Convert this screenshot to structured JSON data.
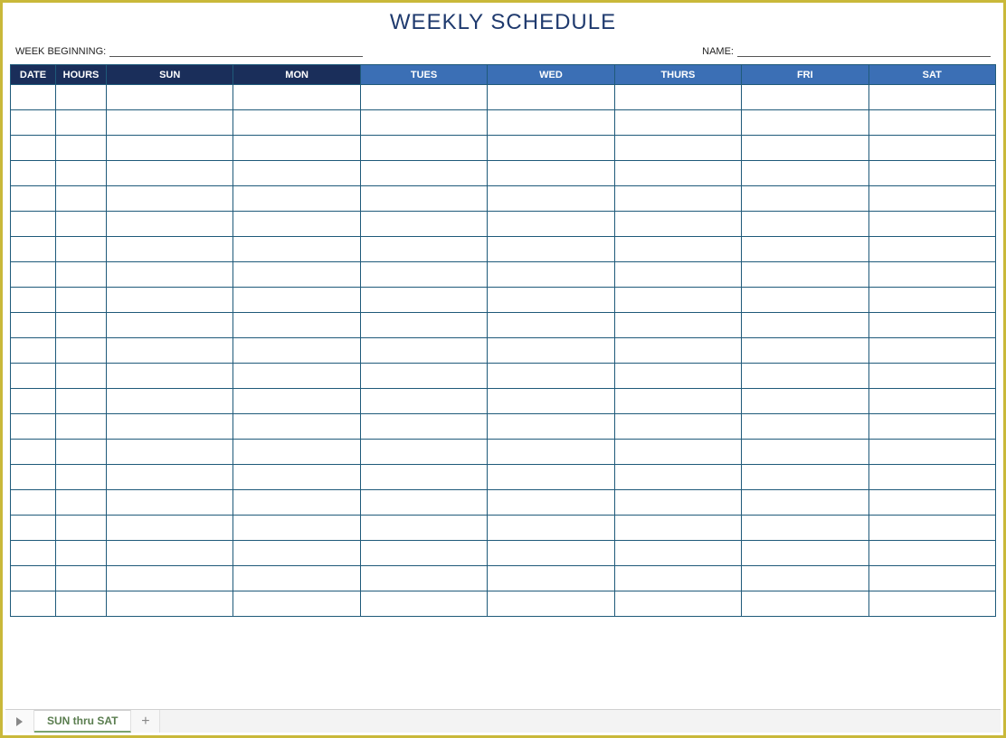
{
  "title": "WEEKLY SCHEDULE",
  "meta": {
    "week_label": "WEEK BEGINNING:",
    "week_value": "",
    "name_label": "NAME:",
    "name_value": ""
  },
  "columns": {
    "date": "DATE",
    "hours": "HOURS",
    "days": [
      "SUN",
      "MON",
      "TUES",
      "WED",
      "THURS",
      "FRI",
      "SAT"
    ]
  },
  "row_count": 21,
  "sheet_tab": "SUN thru SAT"
}
